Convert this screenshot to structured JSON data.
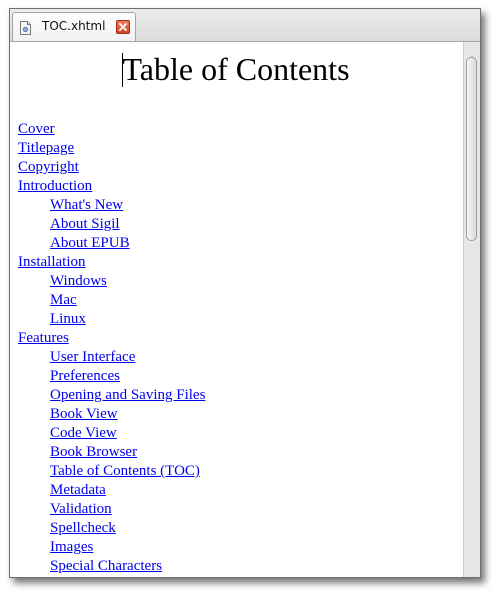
{
  "tab": {
    "label": "TOC.xhtml",
    "icon": "document-icon",
    "close_icon": "close-icon"
  },
  "document": {
    "title": "Table of Contents",
    "entries": [
      {
        "label": "Cover",
        "level": 1
      },
      {
        "label": "Titlepage",
        "level": 1
      },
      {
        "label": "Copyright",
        "level": 1
      },
      {
        "label": "Introduction",
        "level": 1
      },
      {
        "label": "What's New",
        "level": 2
      },
      {
        "label": "About Sigil",
        "level": 2
      },
      {
        "label": "About EPUB",
        "level": 2
      },
      {
        "label": "Installation",
        "level": 1
      },
      {
        "label": "Windows",
        "level": 2
      },
      {
        "label": "Mac",
        "level": 2
      },
      {
        "label": "Linux",
        "level": 2
      },
      {
        "label": "Features",
        "level": 1
      },
      {
        "label": "User Interface",
        "level": 2
      },
      {
        "label": "Preferences",
        "level": 2
      },
      {
        "label": "Opening and Saving Files",
        "level": 2
      },
      {
        "label": "Book View",
        "level": 2
      },
      {
        "label": "Code View",
        "level": 2
      },
      {
        "label": "Book Browser",
        "level": 2
      },
      {
        "label": "Table of Contents (TOC)",
        "level": 2
      },
      {
        "label": "Metadata",
        "level": 2
      },
      {
        "label": "Validation",
        "level": 2
      },
      {
        "label": "Spellcheck",
        "level": 2
      },
      {
        "label": "Images",
        "level": 2
      },
      {
        "label": "Special Characters",
        "level": 2
      }
    ]
  },
  "colors": {
    "link": "#0000ee",
    "close_button": "#d8432a"
  }
}
